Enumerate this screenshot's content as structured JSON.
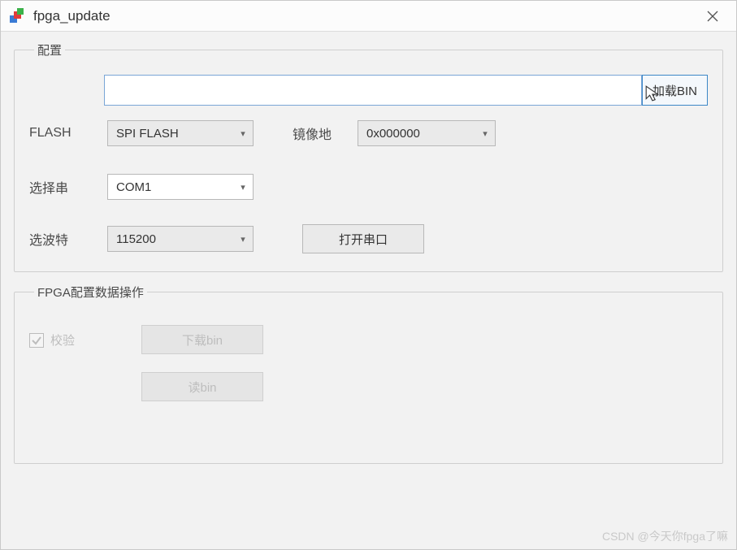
{
  "window": {
    "title": "fpga_update"
  },
  "config": {
    "legend": "配置",
    "file_path": "",
    "load_bin_label": "加载BIN",
    "flash_label": "FLASH",
    "flash_value": "SPI FLASH",
    "mirror_addr_label": "镜像地",
    "mirror_addr_value": "0x000000",
    "serial_label": "选择串",
    "serial_value": "COM1",
    "baud_label": "选波特",
    "baud_value": "115200",
    "open_port_label": "打开串口"
  },
  "ops": {
    "legend": "FPGA配置数据操作",
    "verify_label": "校验",
    "verify_checked": true,
    "download_label": "下载bin",
    "read_label": "读bin"
  },
  "watermark": "CSDN @今天你fpga了嘛"
}
